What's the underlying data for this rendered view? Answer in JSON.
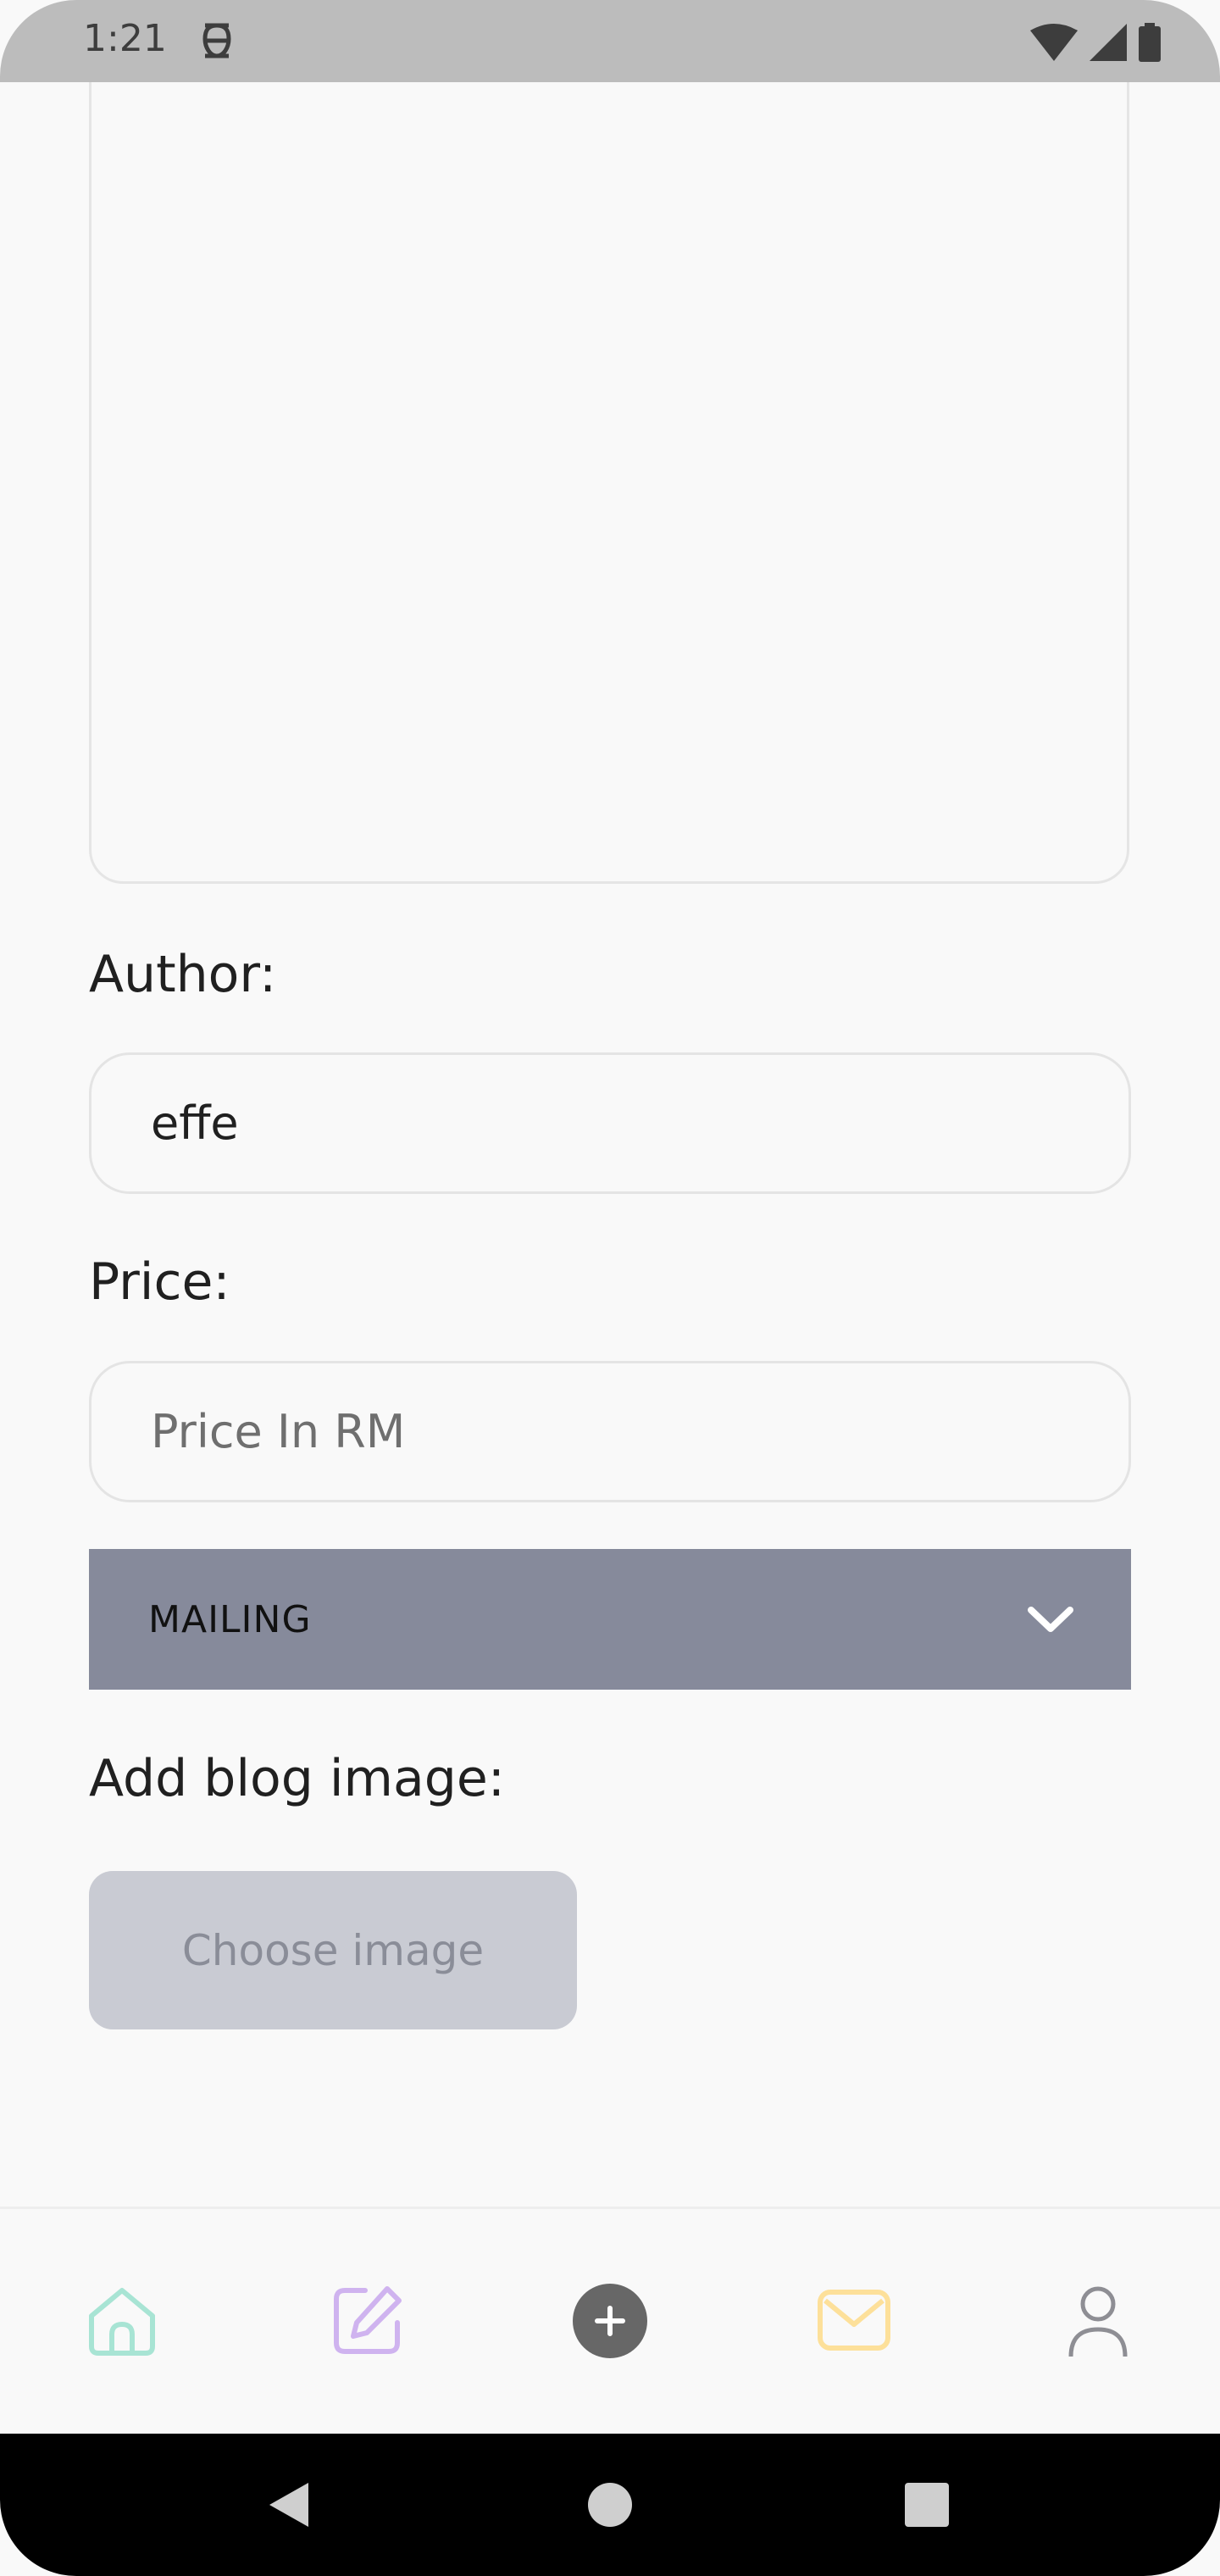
{
  "status_bar": {
    "time": "1:21",
    "icons": [
      "notification-icon",
      "wifi-icon",
      "signal-icon",
      "battery-icon"
    ]
  },
  "form": {
    "author_label": "Author:",
    "author_value": "effe",
    "price_label": "Price:",
    "price_placeholder": "Price In RM",
    "category_selected": "MAILING",
    "image_label": "Add blog image:",
    "choose_image_label": "Choose image"
  },
  "bottom_nav": {
    "items": [
      {
        "icon": "home-icon",
        "color": "#a8e4d4"
      },
      {
        "icon": "edit-icon",
        "color": "#cfb3ef"
      },
      {
        "icon": "add-icon",
        "color": "#676767"
      },
      {
        "icon": "mail-icon",
        "color": "#fde09a"
      },
      {
        "icon": "user-icon",
        "color": "#8e8e94"
      }
    ]
  },
  "colors": {
    "dropdown_bg": "#868a9b",
    "button_bg": "#c9cbd3",
    "status_bar_bg": "#bcbcbc"
  }
}
